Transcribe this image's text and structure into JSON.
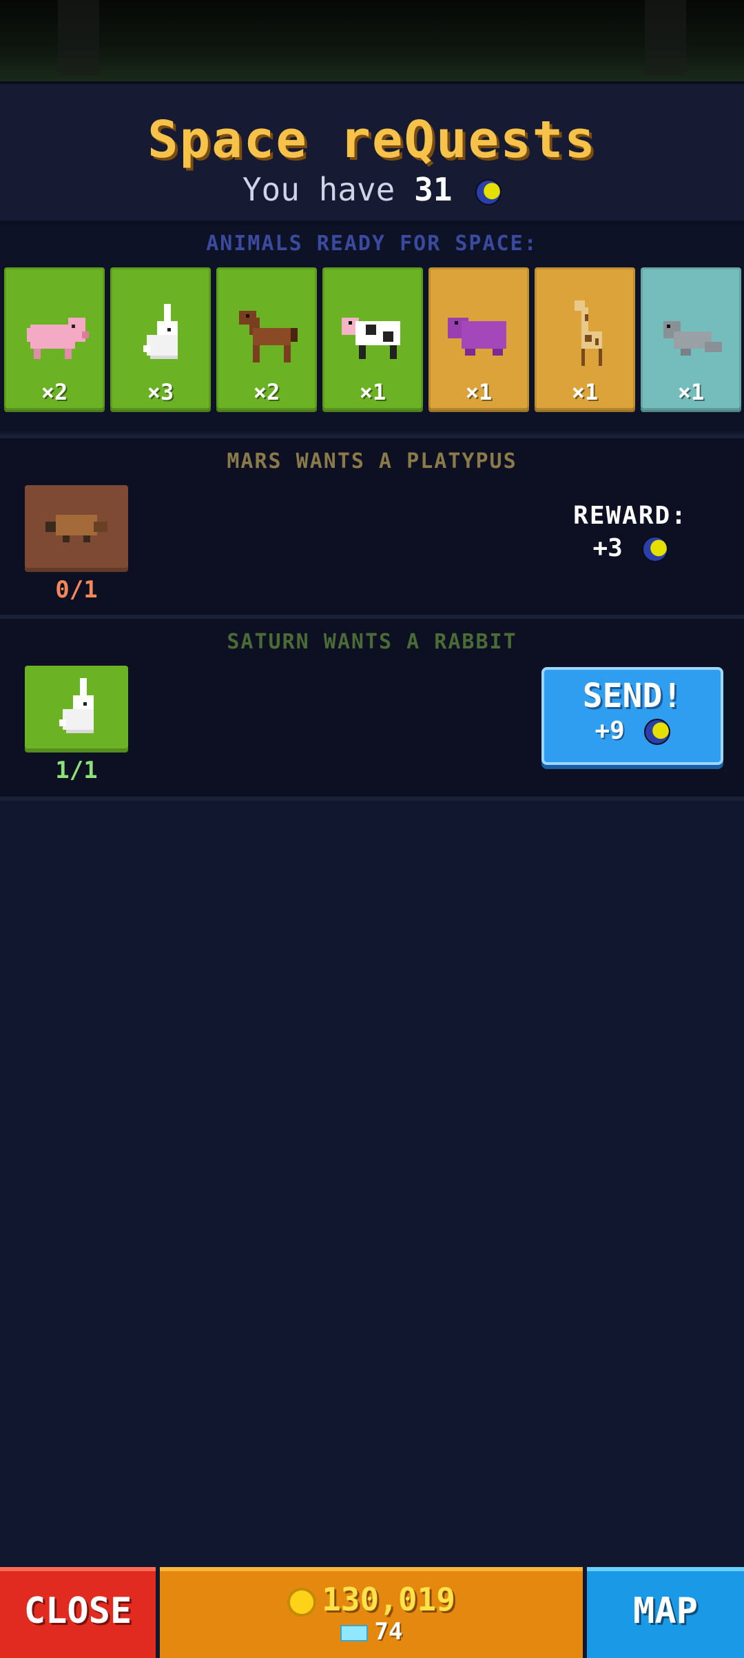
{
  "header": {
    "title": "Space reQuests",
    "subtitle_prefix": "You have",
    "moon_amount": "31",
    "moon_icon": "moon-currency-icon"
  },
  "animals": {
    "label": "ANIMALS READY FOR SPACE:",
    "items": [
      {
        "name": "pig",
        "count": "×2",
        "card_color": "#6cb225"
      },
      {
        "name": "rabbit",
        "count": "×3",
        "card_color": "#6cb225"
      },
      {
        "name": "horse",
        "count": "×2",
        "card_color": "#6cb225"
      },
      {
        "name": "cow",
        "count": "×1",
        "card_color": "#6cb225"
      },
      {
        "name": "hippo",
        "count": "×1",
        "card_color": "#dba33a"
      },
      {
        "name": "giraffe",
        "count": "×1",
        "card_color": "#dba33a"
      },
      {
        "name": "seal",
        "count": "×1",
        "card_color": "#74bdbc"
      }
    ]
  },
  "requests": [
    {
      "title": "MARS WANTS A PLATYPUS",
      "animal": "platypus",
      "progress": "0/1",
      "reward_label": "REWARD:",
      "reward_value": "+3"
    },
    {
      "title": "SATURN WANTS A RABBIT",
      "animal": "rabbit",
      "progress": "1/1",
      "send_label": "SEND!",
      "reward_value": "+9"
    }
  ],
  "bottom_bar": {
    "close_label": "CLOSE",
    "coins": "130,019",
    "gems": "74",
    "map_label": "MAP"
  },
  "colors": {
    "background": "#121730",
    "title": "#f6c24a",
    "send_button": "#2f9ef0",
    "close_button": "#e12a20",
    "wallet": "#e48810",
    "map_button": "#1a9ae6"
  }
}
